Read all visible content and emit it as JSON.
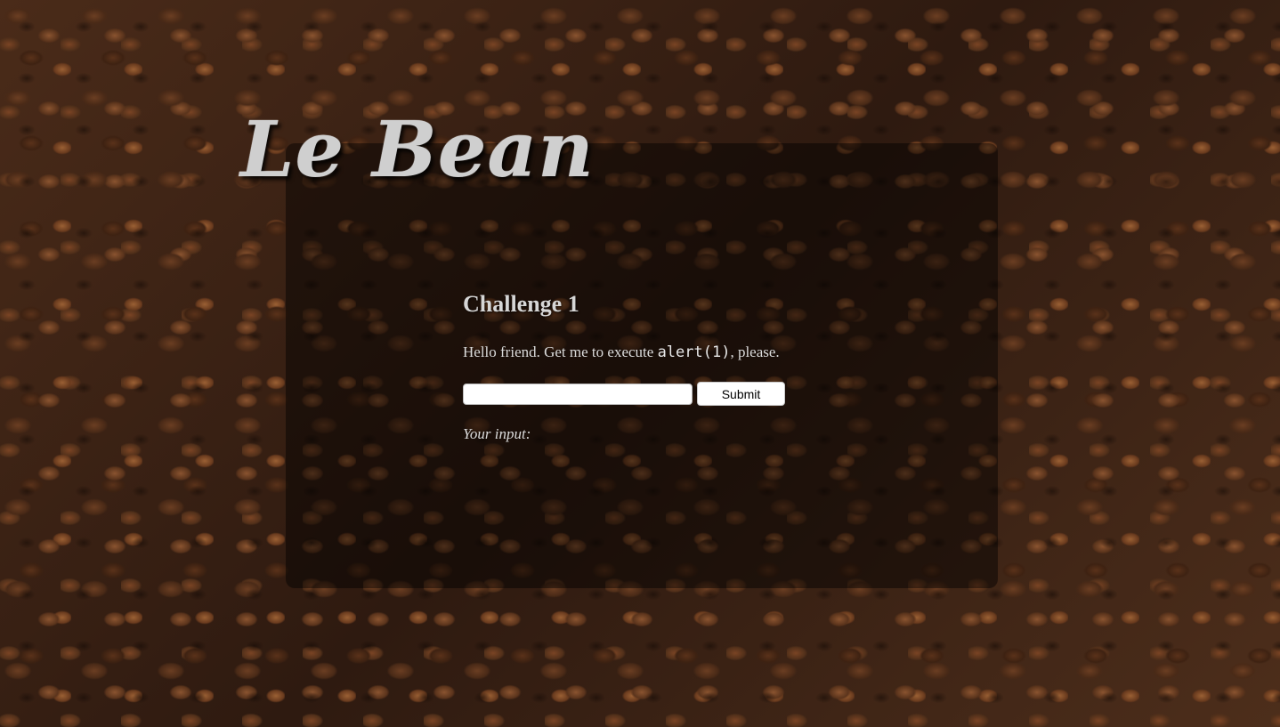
{
  "logo": {
    "text": "Le Bean"
  },
  "challenge": {
    "title": "Challenge 1",
    "instruction_before": "Hello friend. Get me to execute ",
    "instruction_code": "alert(1)",
    "instruction_after": ", please.",
    "input_value": "",
    "submit_label": "Submit",
    "your_input_label": "Your input:"
  },
  "colors": {
    "panel_overlay": "#000000",
    "logo_text": "#cfcfcf",
    "body_text": "#d8d8d8"
  }
}
